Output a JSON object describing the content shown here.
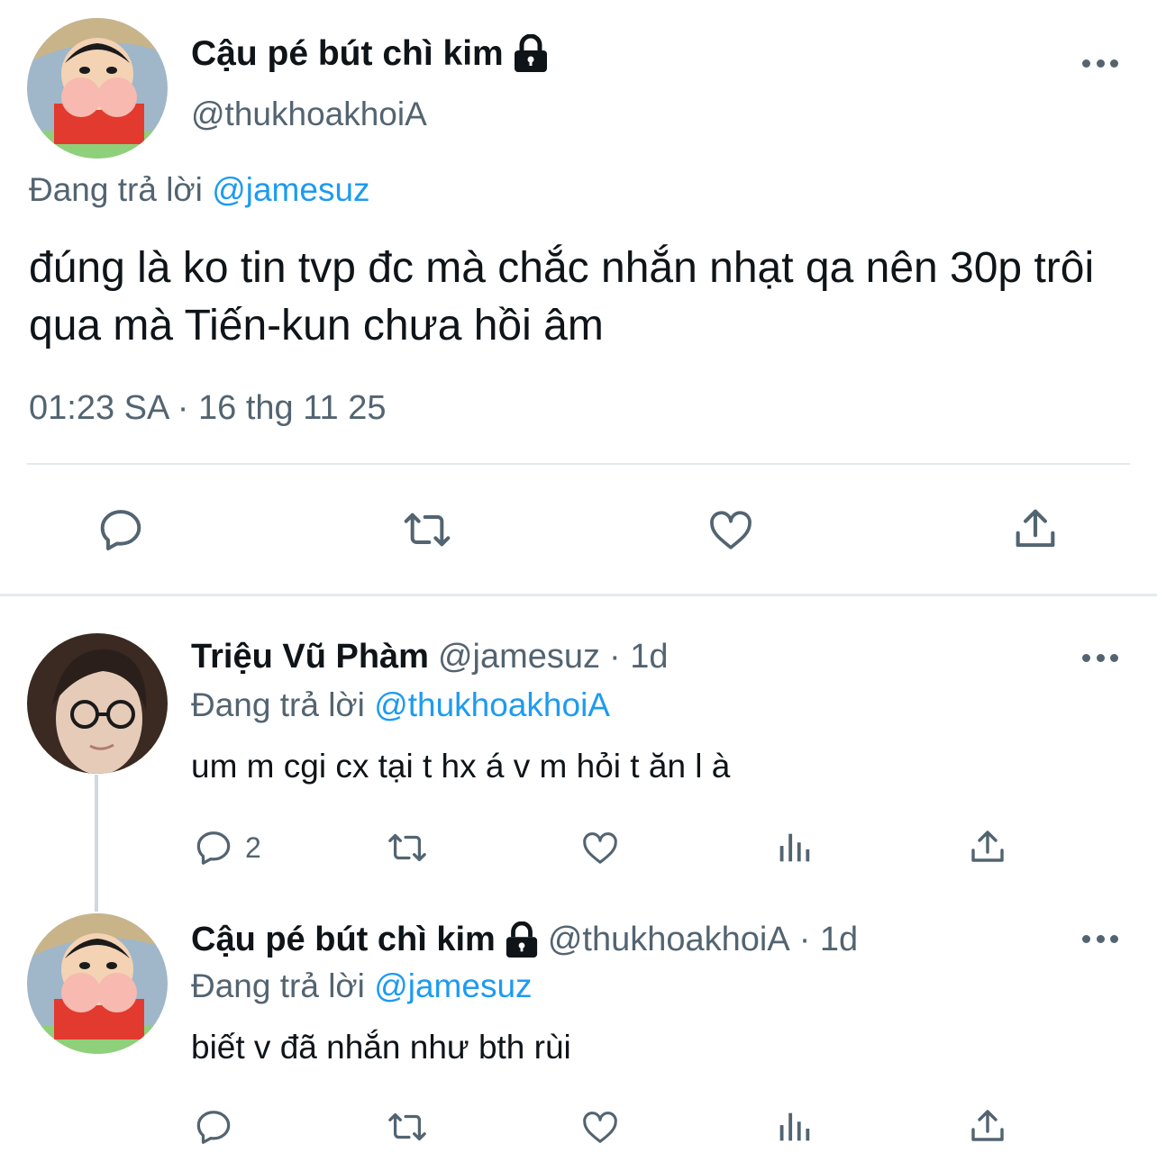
{
  "main_tweet": {
    "display_name": "Cậu pé bút chì kim",
    "handle": "@thukhoakhoiA",
    "replying_prefix": "Đang trả lời",
    "replying_to": "@jamesuz",
    "text": "đúng là ko tin tvp đc mà chắc nhắn nhạt qa nên 30p trôi qua mà Tiến-kun chưa hồi âm",
    "timestamp": "01:23 SA · 16 thg 11 25",
    "actions": [
      "reply-icon",
      "retweet-icon",
      "like-icon",
      "share-icon"
    ]
  },
  "replies": [
    {
      "display_name": "Triệu Vũ Phàm",
      "handle": "@jamesuz",
      "time": "· 1d",
      "replying_prefix": "Đang trả lời",
      "replying_to": "@thukhoakhoiA",
      "text": "um m cgi cx tại t hx á v m hỏi t ăn l à",
      "reply_count": "2"
    },
    {
      "display_name": "Cậu pé bút chì kim",
      "handle": "@thukhoakhoiA",
      "time": "· 1d",
      "replying_prefix": "Đang trả lời",
      "replying_to": "@jamesuz",
      "text": "biết v đã nhắn như bth rùi",
      "reply_count": ""
    }
  ],
  "colors": {
    "text": "#0f1419",
    "secondary": "#536471",
    "link": "#1d9bf0",
    "divider": "#e6e9ec"
  }
}
